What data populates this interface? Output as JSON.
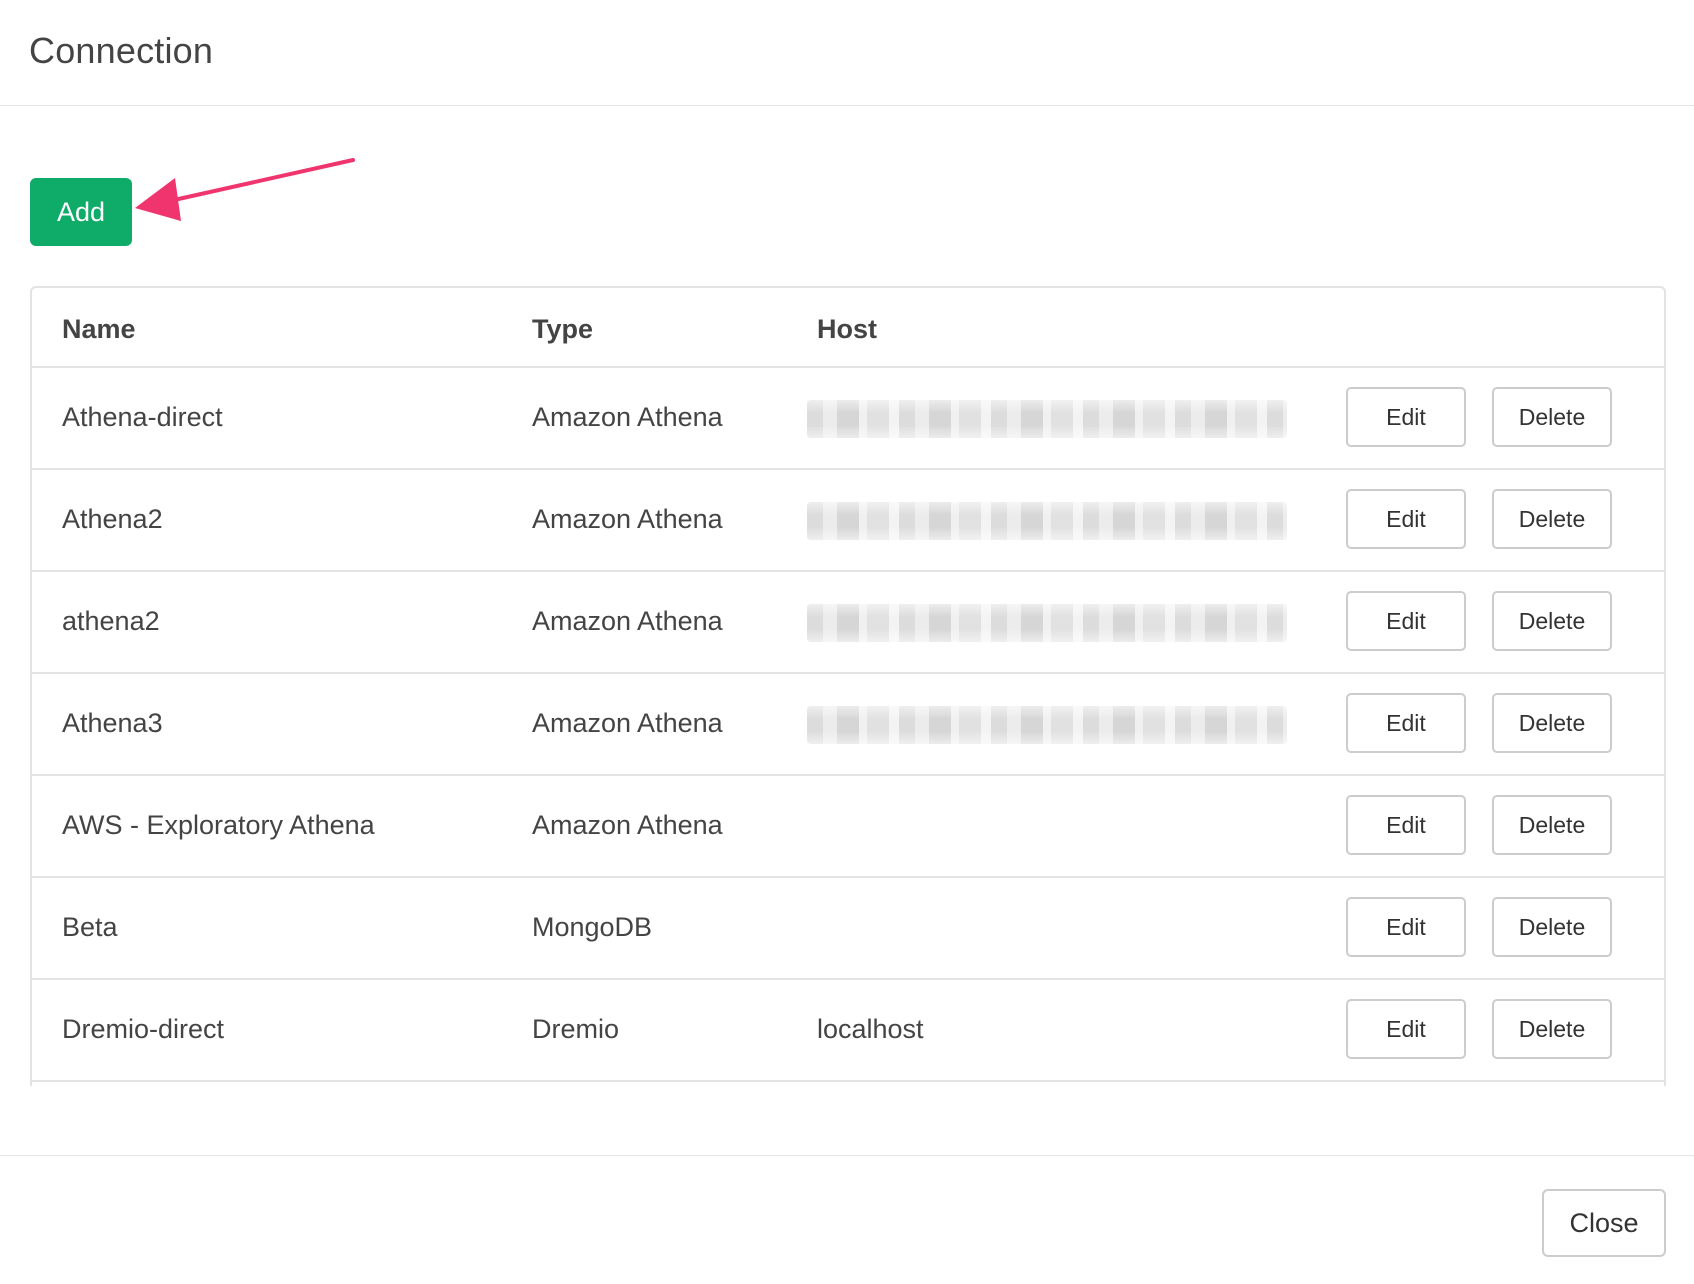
{
  "dialog": {
    "title": "Connection",
    "add_label": "Add",
    "close_label": "Close",
    "callout_color": "#f0356e",
    "accent_color": "#0fab68"
  },
  "table": {
    "headers": {
      "name": "Name",
      "type": "Type",
      "host": "Host"
    },
    "rows": [
      {
        "name": "Athena-direct",
        "type": "Amazon Athena",
        "host": "",
        "host_obscured": true,
        "edit": "Edit",
        "delete": "Delete"
      },
      {
        "name": "Athena2",
        "type": "Amazon Athena",
        "host": "",
        "host_obscured": true,
        "edit": "Edit",
        "delete": "Delete"
      },
      {
        "name": "athena2",
        "type": "Amazon Athena",
        "host": "",
        "host_obscured": true,
        "edit": "Edit",
        "delete": "Delete"
      },
      {
        "name": "Athena3",
        "type": "Amazon Athena",
        "host": "",
        "host_obscured": true,
        "edit": "Edit",
        "delete": "Delete"
      },
      {
        "name": "AWS - Exploratory Athena",
        "type": "Amazon Athena",
        "host": "",
        "host_obscured": false,
        "edit": "Edit",
        "delete": "Delete"
      },
      {
        "name": "Beta",
        "type": "MongoDB",
        "host": "",
        "host_obscured": false,
        "edit": "Edit",
        "delete": "Delete"
      },
      {
        "name": "Dremio-direct",
        "type": "Dremio",
        "host": "localhost",
        "host_obscured": false,
        "edit": "Edit",
        "delete": "Delete"
      }
    ]
  }
}
